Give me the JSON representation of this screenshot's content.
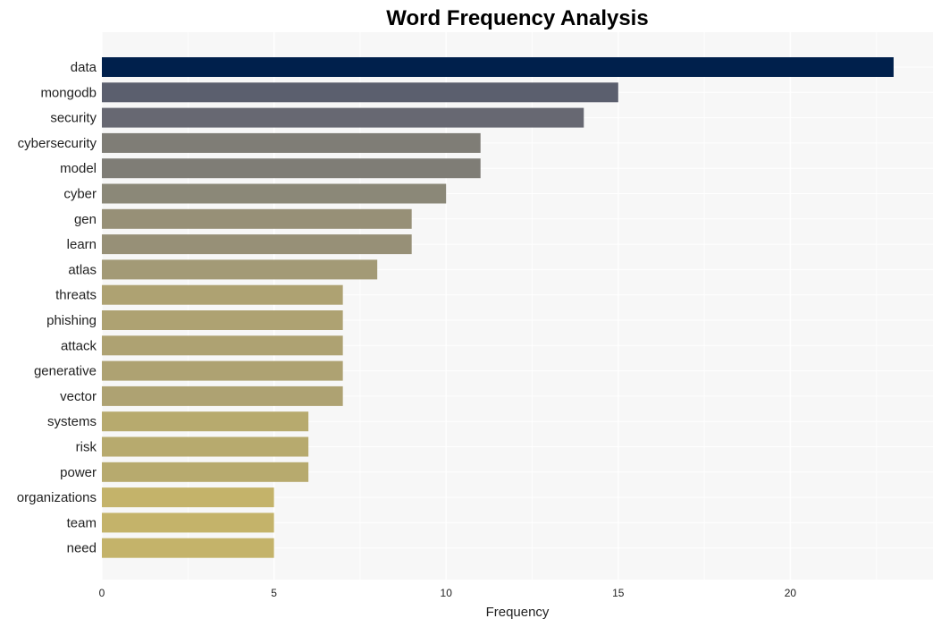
{
  "chart_data": {
    "type": "bar",
    "orientation": "horizontal",
    "title": "Word Frequency Analysis",
    "xlabel": "Frequency",
    "ylabel": "",
    "xlim": [
      0,
      24
    ],
    "xticks": [
      0,
      5,
      10,
      15,
      20
    ],
    "grid": true,
    "legend": "none",
    "categories": [
      "data",
      "mongodb",
      "security",
      "cybersecurity",
      "model",
      "cyber",
      "gen",
      "learn",
      "atlas",
      "threats",
      "phishing",
      "attack",
      "generative",
      "vector",
      "systems",
      "risk",
      "power",
      "organizations",
      "team",
      "need"
    ],
    "values": [
      23,
      15,
      14,
      11,
      11,
      10,
      9,
      9,
      8,
      7,
      7,
      7,
      7,
      7,
      6,
      6,
      6,
      5,
      5,
      5
    ],
    "colors": [
      "#00204c",
      "#5b5f6e",
      "#676872",
      "#7f7d76",
      "#7f7d76",
      "#8b8878",
      "#979077",
      "#979077",
      "#a39a76",
      "#aea272",
      "#aea272",
      "#aea272",
      "#aea272",
      "#aea272",
      "#b7aa6e",
      "#b7aa6e",
      "#b7aa6e",
      "#c4b36a",
      "#c4b36a",
      "#c4b36a"
    ]
  }
}
